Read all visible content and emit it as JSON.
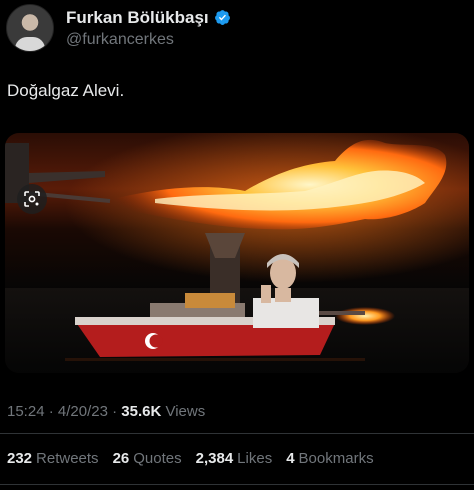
{
  "author": {
    "name": "Furkan Bölükbaşı",
    "handle": "@furkancerkes"
  },
  "tweet": {
    "text": "Doğalgaz Alevi."
  },
  "meta": {
    "time": "15:24",
    "sep1": "·",
    "date": "4/20/23",
    "sep2": "·",
    "views_count": "35.6K",
    "views_label": "Views"
  },
  "stats": [
    {
      "count": "232",
      "label": "Retweets"
    },
    {
      "count": "26",
      "label": "Quotes"
    },
    {
      "count": "2,384",
      "label": "Likes"
    },
    {
      "count": "4",
      "label": "Bookmarks"
    }
  ],
  "colors": {
    "background": "#000000",
    "text": "#e7e9ea",
    "secondary": "#71767b",
    "verified": "#1d9bf0",
    "divider": "#2f3336"
  },
  "icons": {
    "verified": "verified-badge-icon",
    "lens": "google-lens-icon"
  }
}
